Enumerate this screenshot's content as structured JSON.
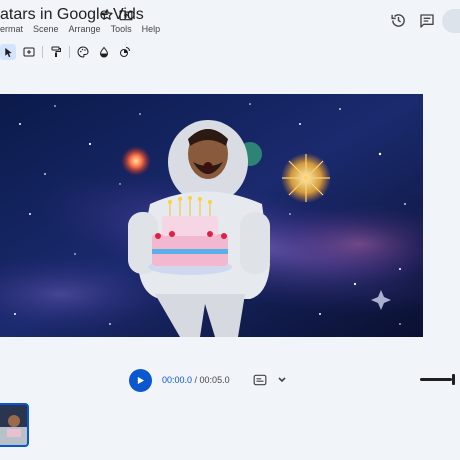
{
  "header": {
    "title": "atars in Google Vids",
    "icons": [
      "star-icon",
      "folder-icon",
      "history-icon",
      "comment-icon"
    ]
  },
  "menu": {
    "items": [
      "ermat",
      "Scene",
      "Arrange",
      "Tools",
      "Help"
    ]
  },
  "toolbar": {
    "tools": [
      "select-tool",
      "text-box-tool",
      "paint-format-tool",
      "palette-tool",
      "fill-tool",
      "effects-tool"
    ],
    "active_tool": "select-tool"
  },
  "playback": {
    "current_time": "00:00.0",
    "separator": " / ",
    "total_time": "00:05.0"
  },
  "colors": {
    "accent": "#0b57d0",
    "background": "#f1f4f9",
    "canvas_background": "#0a1130"
  }
}
